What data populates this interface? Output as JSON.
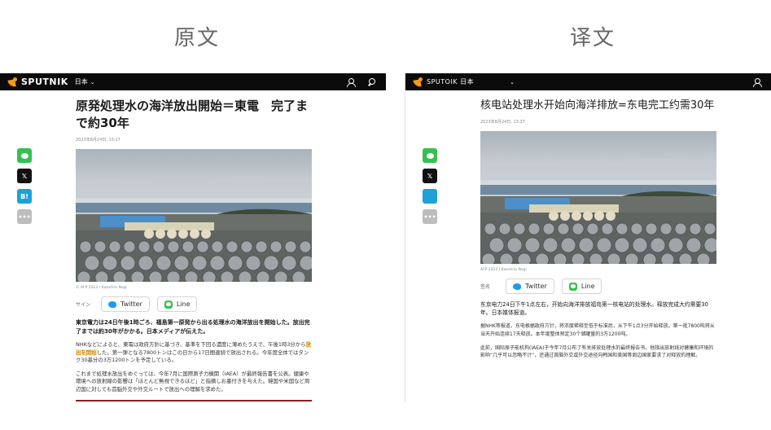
{
  "labels": {
    "original": "原文",
    "translated": "译文"
  },
  "left": {
    "brand": "SPUTNIK",
    "region": "日本",
    "headline": "原発処理水の海洋放出開始＝東電　完了まで約30年",
    "date": "2023年8月24日, 13:17",
    "credit": "© AFP 2023 / Kazuhiro Nogi",
    "share_label": "サイン",
    "twitter_label": "Twitter",
    "line_label": "Line",
    "lead": "東京電力は24日午後1時ごろ、福島第一原発から出る処理水の海洋放出を開始した。放出完了までは約30年がかかる。日本メディアが伝えた。",
    "para1_before": "NHKなどによると、東電は政府方針に基づき、基準を下回る濃度に薄めたうえで、午後1時3分から",
    "para1_highlight": "放出を開始",
    "para1_after": "した。第一弾となる7800トンはこの日から17日間連続で放出される。今年度全体ではタンク30基分の3万1200トンを予定している。",
    "para2": "これまで処理水放出をめぐっては、今年7月に国際原子力機関（IAEA）が最終報告書を公表。健康や環境への放射線の影響は「ほとんど無視できるほど」と指摘しお墨付きを与えた。韓国や米国など周辺国に対しても首脳外交や外交ルートで放出への理解を求めた。"
  },
  "right": {
    "brand": "SPUTOIK 日本",
    "headline": "核电站处理水开始向海洋排放=东电完工约需30年",
    "date": "2023年8月24日, 13:37",
    "credit": "AFP 2023 / Kazuhiro Nogi",
    "share_label": "签名",
    "twitter_label": "Twitter",
    "line_label": "Line",
    "lead": "东京电力24日下午1点左右，开始向海洋排放福岛第一核电站的处理水。释放完成大约需要30年。日本媒体报道。",
    "para1": "据NHK等报道，东电根据政府方针，将浓度稀释至低于标准后，从下午1点3分开始释放。第一批7800吨将从当天开始连续17天释放。本年度整体预定30个储罐量的3万1200吨。",
    "para2": "此前，国际原子能机构(IAEA)于今年7月公布了有关排放处理水的最终报告书。他指出放射线对健康和环境的影响“几乎可以忽略不计”，还通过首脑外交或外交途径向韩国和美国等周边国家要求了对释放的理解。"
  },
  "colors": {
    "topbar": "#0b0b0b",
    "brand_orange": "#f39a1e",
    "line_green": "#35c151",
    "twitter_blue": "#1d9bf0",
    "highlight": "#fbe6a8",
    "rule_red": "#8a1f1f"
  },
  "icons": [
    "sputnik-logo-icon",
    "chevron-down-icon",
    "user-icon",
    "search-icon",
    "line-share-icon",
    "x-share-icon",
    "hatena-share-icon",
    "more-icon",
    "twitter-icon",
    "line-icon"
  ]
}
